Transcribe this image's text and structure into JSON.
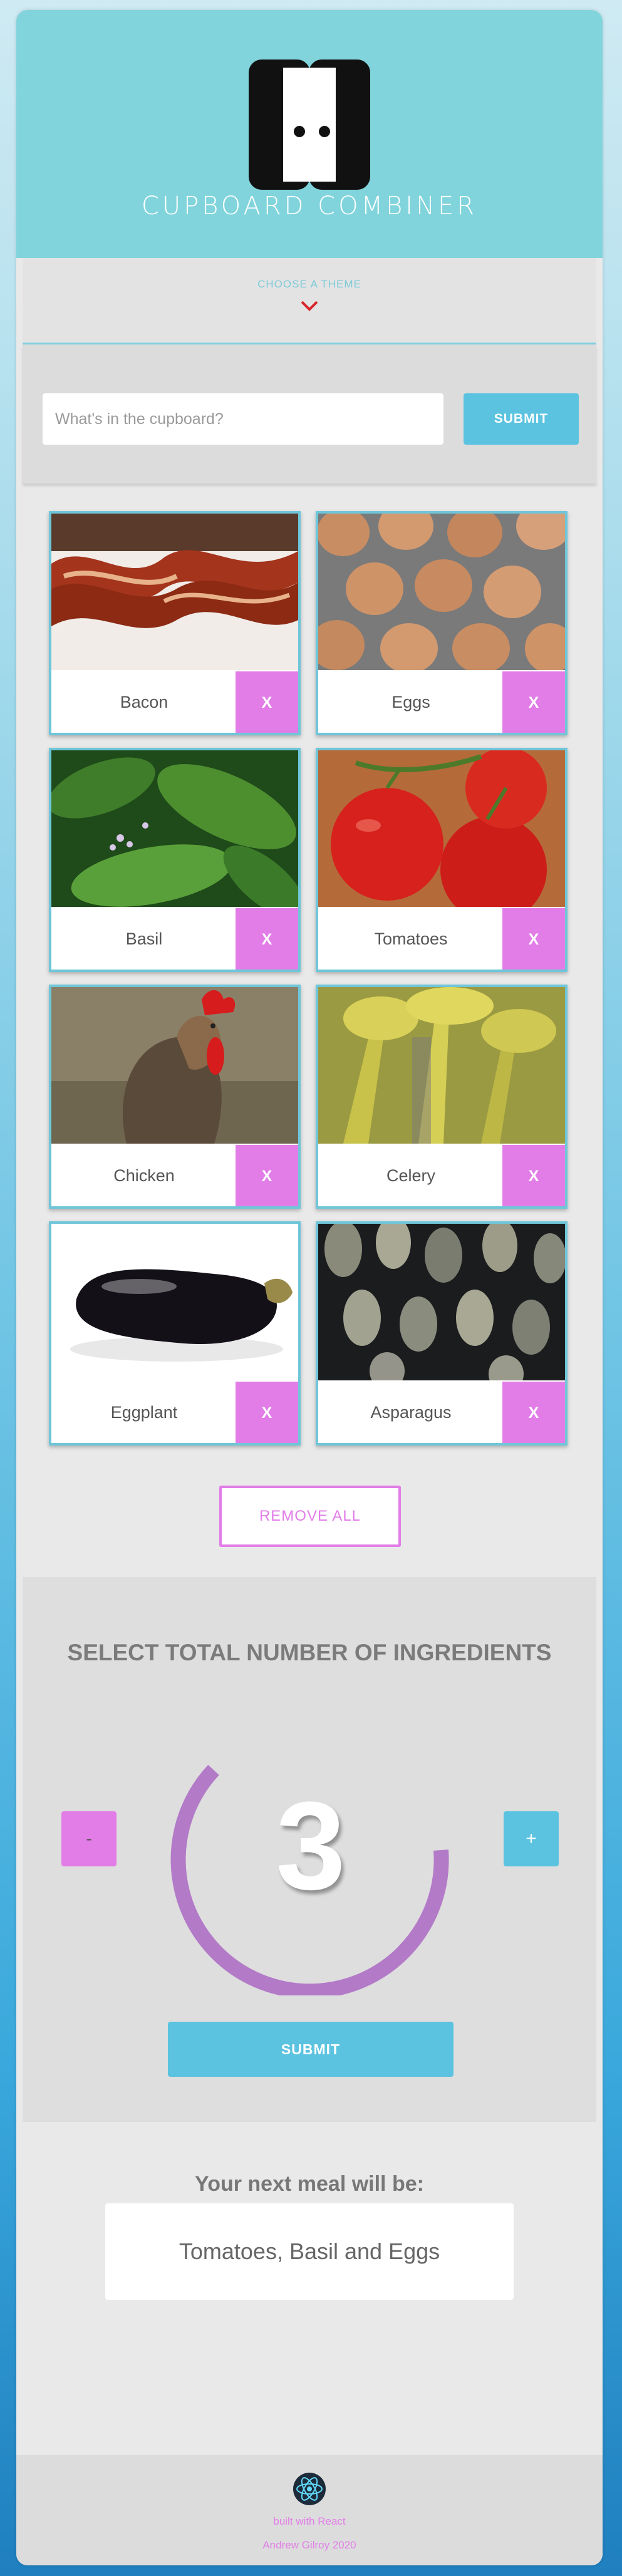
{
  "app": {
    "title": "CUPBOARD COMBINER"
  },
  "theme": {
    "label": "CHOOSE A THEME",
    "icon": "chevron-down-icon",
    "accent": "#d9262a"
  },
  "search": {
    "placeholder": "What's in the cupboard?",
    "value": "",
    "submit_label": "SUBMIT"
  },
  "ingredients": [
    {
      "name": "Bacon",
      "remove_label": "X"
    },
    {
      "name": "Eggs",
      "remove_label": "X"
    },
    {
      "name": "Basil",
      "remove_label": "X"
    },
    {
      "name": "Tomatoes",
      "remove_label": "X"
    },
    {
      "name": "Chicken",
      "remove_label": "X"
    },
    {
      "name": "Celery",
      "remove_label": "X"
    },
    {
      "name": "Eggplant",
      "remove_label": "X"
    },
    {
      "name": "Asparagus",
      "remove_label": "X"
    }
  ],
  "remove_all_label": "REMOVE ALL",
  "selector": {
    "title": "SELECT TOTAL NUMBER OF INGREDIENTS",
    "minus_label": "-",
    "plus_label": "+",
    "count": "3",
    "submit_label": "SUBMIT"
  },
  "result": {
    "title": "Your next meal will be:",
    "meal": "Tomatoes, Basil and Eggs"
  },
  "footer": {
    "built_with": "built with React",
    "author": "Andrew Gilroy 2020",
    "icon": "react-icon"
  },
  "colors": {
    "header": "#81d4dc",
    "primary": "#5bc3e0",
    "pink": "#e27de8",
    "dial": "#b37ac8"
  }
}
